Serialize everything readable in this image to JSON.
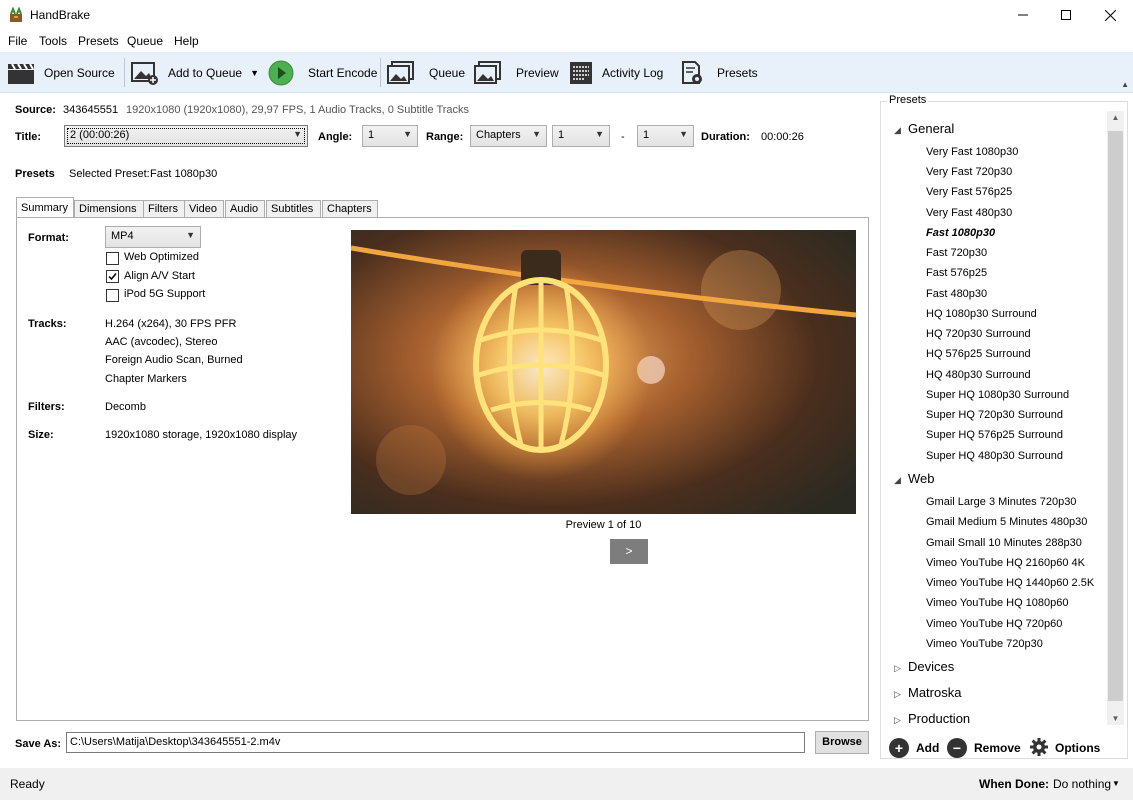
{
  "window": {
    "title": "HandBrake"
  },
  "menu": [
    "File",
    "Tools",
    "Presets",
    "Queue",
    "Help"
  ],
  "toolbar": {
    "open_source": "Open Source",
    "add_to_queue": "Add to Queue",
    "start_encode": "Start Encode",
    "queue": "Queue",
    "preview": "Preview",
    "activity_log": "Activity Log",
    "presets": "Presets"
  },
  "source": {
    "label": "Source:",
    "name": "343645551",
    "info": "1920x1080 (1920x1080), 29,97 FPS, 1 Audio Tracks, 0 Subtitle Tracks"
  },
  "title_row": {
    "title_label": "Title:",
    "title_value": "2 (00:00:26)",
    "angle_label": "Angle:",
    "angle_value": "1",
    "range_label": "Range:",
    "range_type": "Chapters",
    "range_start": "1",
    "range_sep": "-",
    "range_end": "1",
    "duration_label": "Duration:",
    "duration_value": "00:00:26"
  },
  "presets_row": {
    "label": "Presets",
    "selected_label": "Selected Preset:",
    "selected_value": "Fast 1080p30"
  },
  "tabs": [
    "Summary",
    "Dimensions",
    "Filters",
    "Video",
    "Audio",
    "Subtitles",
    "Chapters"
  ],
  "summary": {
    "format_label": "Format:",
    "format_value": "MP4",
    "web_optimized": {
      "label": "Web Optimized",
      "checked": false
    },
    "align_av": {
      "label": "Align A/V Start",
      "checked": true
    },
    "ipod": {
      "label": "iPod 5G Support",
      "checked": false
    },
    "tracks_label": "Tracks:",
    "tracks": [
      "H.264 (x264), 30 FPS PFR",
      "AAC (avcodec), Stereo",
      "Foreign Audio Scan, Burned",
      "Chapter Markers"
    ],
    "filters_label": "Filters:",
    "filters_value": "Decomb",
    "size_label": "Size:",
    "size_value": "1920x1080 storage, 1920x1080 display",
    "preview_caption": "Preview 1 of 10",
    "preview_next": ">"
  },
  "save_as": {
    "label": "Save As:",
    "path": "C:\\Users\\Matija\\Desktop\\343645551-2.m4v",
    "browse": "Browse"
  },
  "status": {
    "text": "Ready",
    "when_done_label": "When Done:",
    "when_done_value": "Do nothing"
  },
  "presets_panel": {
    "title": "Presets",
    "categories": [
      {
        "name": "General",
        "expanded": true,
        "items": [
          "Very Fast 1080p30",
          "Very Fast 720p30",
          "Very Fast 576p25",
          "Very Fast 480p30",
          "Fast 1080p30",
          "Fast 720p30",
          "Fast 576p25",
          "Fast 480p30",
          "HQ 1080p30 Surround",
          "HQ 720p30 Surround",
          "HQ 576p25 Surround",
          "HQ 480p30 Surround",
          "Super HQ 1080p30 Surround",
          "Super HQ 720p30 Surround",
          "Super HQ 576p25 Surround",
          "Super HQ 480p30 Surround"
        ]
      },
      {
        "name": "Web",
        "expanded": true,
        "items": [
          "Gmail Large 3 Minutes 720p30",
          "Gmail Medium 5 Minutes 480p30",
          "Gmail Small 10 Minutes 288p30",
          "Vimeo YouTube HQ 2160p60 4K",
          "Vimeo YouTube HQ 1440p60 2.5K",
          "Vimeo YouTube HQ 1080p60",
          "Vimeo YouTube HQ 720p60",
          "Vimeo YouTube 720p30"
        ]
      },
      {
        "name": "Devices",
        "expanded": false,
        "items": []
      },
      {
        "name": "Matroska",
        "expanded": false,
        "items": []
      },
      {
        "name": "Production",
        "expanded": false,
        "items": []
      }
    ],
    "selected": "Fast 1080p30",
    "add": "Add",
    "remove": "Remove",
    "options": "Options"
  }
}
